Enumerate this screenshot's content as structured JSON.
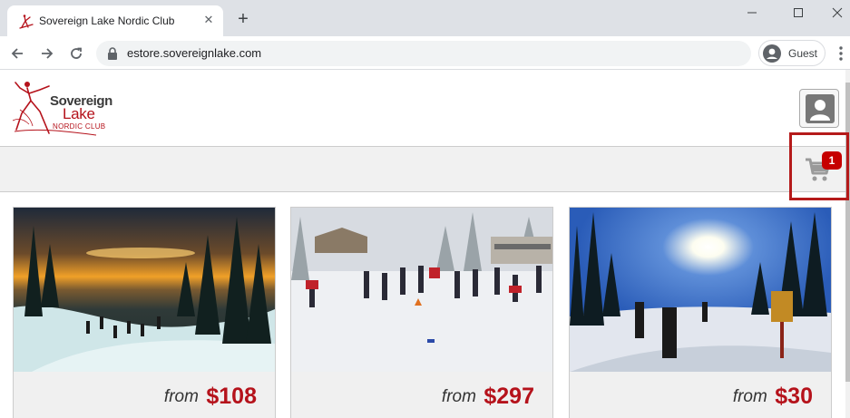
{
  "browser": {
    "tab_title": "Sovereign Lake Nordic Club",
    "url": "estore.sovereignlake.com",
    "profile_label": "Guest"
  },
  "header": {
    "logo_line1": "Sovereign",
    "logo_line2": "Lake",
    "logo_line3": "NORDIC CLUB"
  },
  "cart": {
    "count": "1"
  },
  "products": [
    {
      "from_label": "from",
      "price": "$108",
      "image": "sunset-ski-trail-photo"
    },
    {
      "from_label": "from",
      "price": "$297",
      "image": "group-ski-lesson-photo"
    },
    {
      "from_label": "from",
      "price": "$30",
      "image": "sunny-snowshoe-trail-photo"
    }
  ],
  "colors": {
    "brand_red": "#b5121b",
    "cart_badge": "#c60000",
    "highlight_border": "#b51a1a"
  }
}
